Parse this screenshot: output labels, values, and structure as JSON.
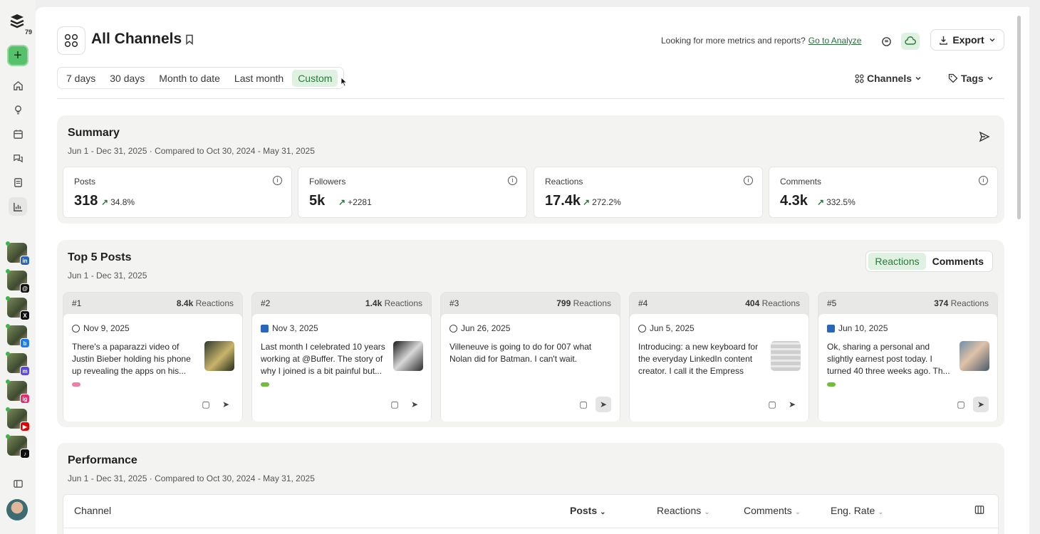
{
  "sidebar": {
    "badge_count": "79",
    "nav_icons": [
      "home-icon",
      "lightbulb-icon",
      "calendar-icon",
      "chat-icon",
      "book-icon",
      "chart-icon"
    ],
    "accounts": [
      {
        "network": "linkedin",
        "color": "#2a66b9",
        "glyph": "in"
      },
      {
        "network": "threads",
        "color": "#111111",
        "glyph": "@"
      },
      {
        "network": "x",
        "color": "#111111",
        "glyph": "X"
      },
      {
        "network": "bluesky",
        "color": "#1d7cf2",
        "glyph": "b"
      },
      {
        "network": "mastodon",
        "color": "#5b4be0",
        "glyph": "m"
      },
      {
        "network": "instagram",
        "color": "#e1306c",
        "glyph": "ig"
      },
      {
        "network": "youtube",
        "color": "#e00000",
        "glyph": "▶"
      },
      {
        "network": "tiktok",
        "color": "#111111",
        "glyph": "♪"
      }
    ]
  },
  "header": {
    "title": "All Channels",
    "analyze_prompt": "Looking for more metrics and reports?",
    "analyze_link": "Go to Analyze",
    "export_label": "Export"
  },
  "date_ranges": [
    "7 days",
    "30 days",
    "Month to date",
    "Last month",
    "Custom"
  ],
  "selected_range": "Custom",
  "filters": {
    "channels": "Channels",
    "tags": "Tags"
  },
  "summary": {
    "title": "Summary",
    "subtitle": "Jun 1 - Dec 31, 2025 · Compared to Oct 30, 2024 - May 31, 2025",
    "metrics": [
      {
        "label": "Posts",
        "value": "318",
        "change": "34.8%"
      },
      {
        "label": "Followers",
        "value": "5k",
        "change": "+2281"
      },
      {
        "label": "Reactions",
        "value": "17.4k",
        "change": "272.2%"
      },
      {
        "label": "Comments",
        "value": "4.3k",
        "change": "332.5%"
      }
    ]
  },
  "top_posts": {
    "title": "Top 5 Posts",
    "subtitle": "Jun 1 - Dec 31, 2025",
    "toggle": {
      "reactions": "Reactions",
      "comments": "Comments",
      "selected": "Reactions"
    },
    "reactions_word": "Reactions",
    "posts": [
      {
        "rank": "#1",
        "count": "8.4k",
        "network": "threads",
        "date": "Nov 9, 2025",
        "text": "There's a paparazzi video of Justin Bieber holding his phone up revealing the apps on his...",
        "tag_color": "#f07fa8",
        "thumb": "linear-gradient(135deg,#2f3a2a,#c9b36a 55%,#1f2a1a)"
      },
      {
        "rank": "#2",
        "count": "1.4k",
        "network": "linkedin",
        "date": "Nov 3, 2025",
        "text": "Last month I celebrated 10 years working at @Buffer. The story of why I joined is a bit painful but...",
        "tag_color": "#6fbf3a",
        "thumb": "linear-gradient(135deg,#1a1a1a,#d8d8d8 50%,#2a2a2a)"
      },
      {
        "rank": "#3",
        "count": "799",
        "network": "threads",
        "date": "Jun 26, 2025",
        "text": "Villeneuve is going to do for 007 what Nolan did for Batman. I can't wait.",
        "tag_color": "",
        "thumb": ""
      },
      {
        "rank": "#4",
        "count": "404",
        "network": "threads",
        "date": "Jun 5, 2025",
        "text": "Introducing: a new keyboard for the everyday LinkedIn content creator. I call it the Empress",
        "tag_color": "",
        "thumb": "repeating-linear-gradient(0deg,#cfcfcf 0 5px,#e9e9e9 5px 8px)"
      },
      {
        "rank": "#5",
        "count": "374",
        "network": "linkedin",
        "date": "Jun 10, 2025",
        "text": "Ok, sharing a personal and slightly earnest post today. I turned 40 three weeks ago. Th...",
        "tag_color": "#6fbf3a",
        "thumb": "linear-gradient(135deg,#6b8fa8,#e0c2a8 45%,#4a5a6a)"
      }
    ]
  },
  "performance": {
    "title": "Performance",
    "subtitle": "Jun 1 - Dec 31, 2025 · Compared to Oct 30, 2024 - May 31, 2025",
    "columns": [
      "Channel",
      "Posts",
      "Reactions",
      "Comments",
      "Eng. Rate"
    ]
  }
}
